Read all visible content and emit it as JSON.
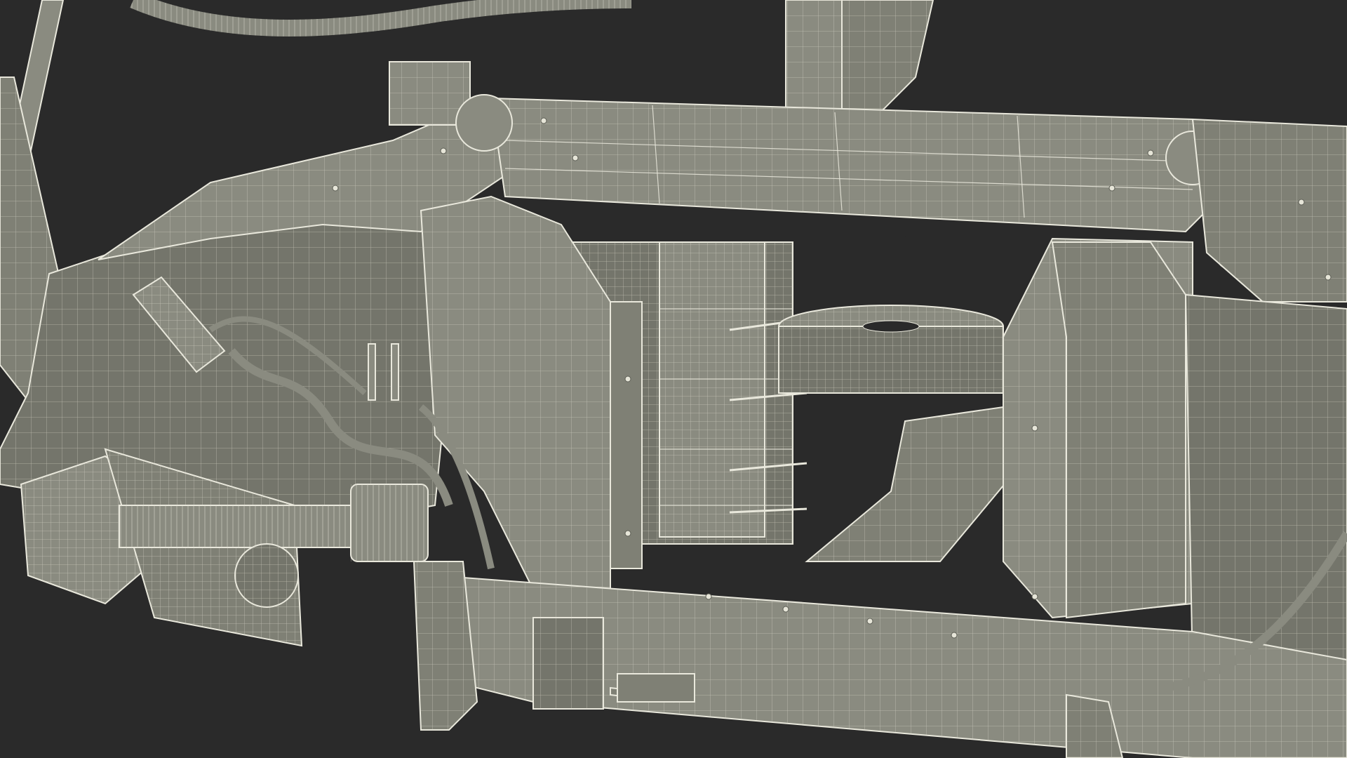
{
  "scene": {
    "background": "#2a2a2a",
    "mesh_fill": "#8a8b80",
    "wire_color": "#e9e8dc"
  }
}
